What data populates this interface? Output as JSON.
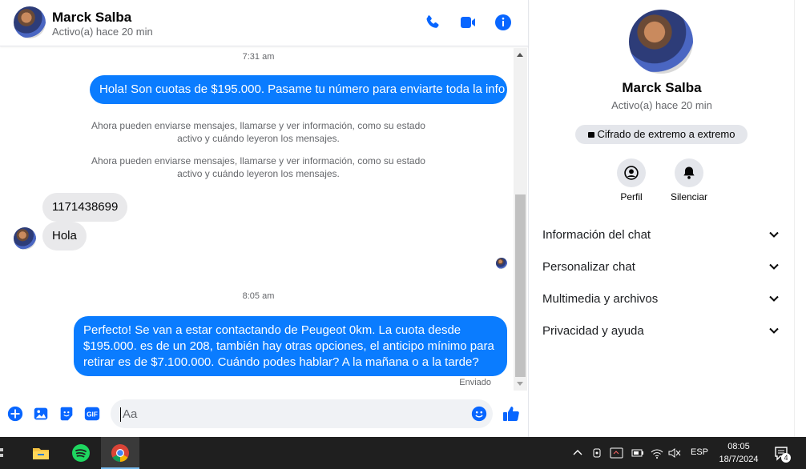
{
  "header": {
    "name": "Marck Salba",
    "status": "Activo(a) hace 20 min"
  },
  "messages": {
    "ts1": "7:31 am",
    "out1": "Hola! Son cuotas de $195.000. Pasame tu número para enviarte toda la info",
    "sys1": "Ahora pueden enviarse mensajes, llamarse y ver información, como su estado activo y cuándo leyeron los mensajes.",
    "sys2": "Ahora pueden enviarse mensajes, llamarse y ver información, como su estado activo y cuándo leyeron los mensajes.",
    "in1": "1171438699",
    "in2": "Hola",
    "ts2": "8:05 am",
    "out2": "Perfecto!  Se van a estar contactando de Peugeot 0km. La cuota desde $195.000. es de un 208, también hay otras opciones, el anticipo mínimo para retirar es de $7.100.000. Cuándo podes hablar? A la mañana o a la tarde?",
    "sent": "Enviado"
  },
  "composer": {
    "placeholder": "Aa"
  },
  "panel": {
    "name": "Marck Salba",
    "status": "Activo(a) hace 20 min",
    "e2e": "Cifrado de extremo a extremo",
    "profile_label": "Perfil",
    "mute_label": "Silenciar",
    "rows": [
      "Información del chat",
      "Personalizar chat",
      "Multimedia y archivos",
      "Privacidad y ayuda"
    ]
  },
  "taskbar": {
    "lang": "ESP",
    "time": "08:05",
    "date": "18/7/2024",
    "notif_count": "4"
  },
  "colors": {
    "accent": "#0a7cff",
    "icon_blue": "#0866ff"
  }
}
